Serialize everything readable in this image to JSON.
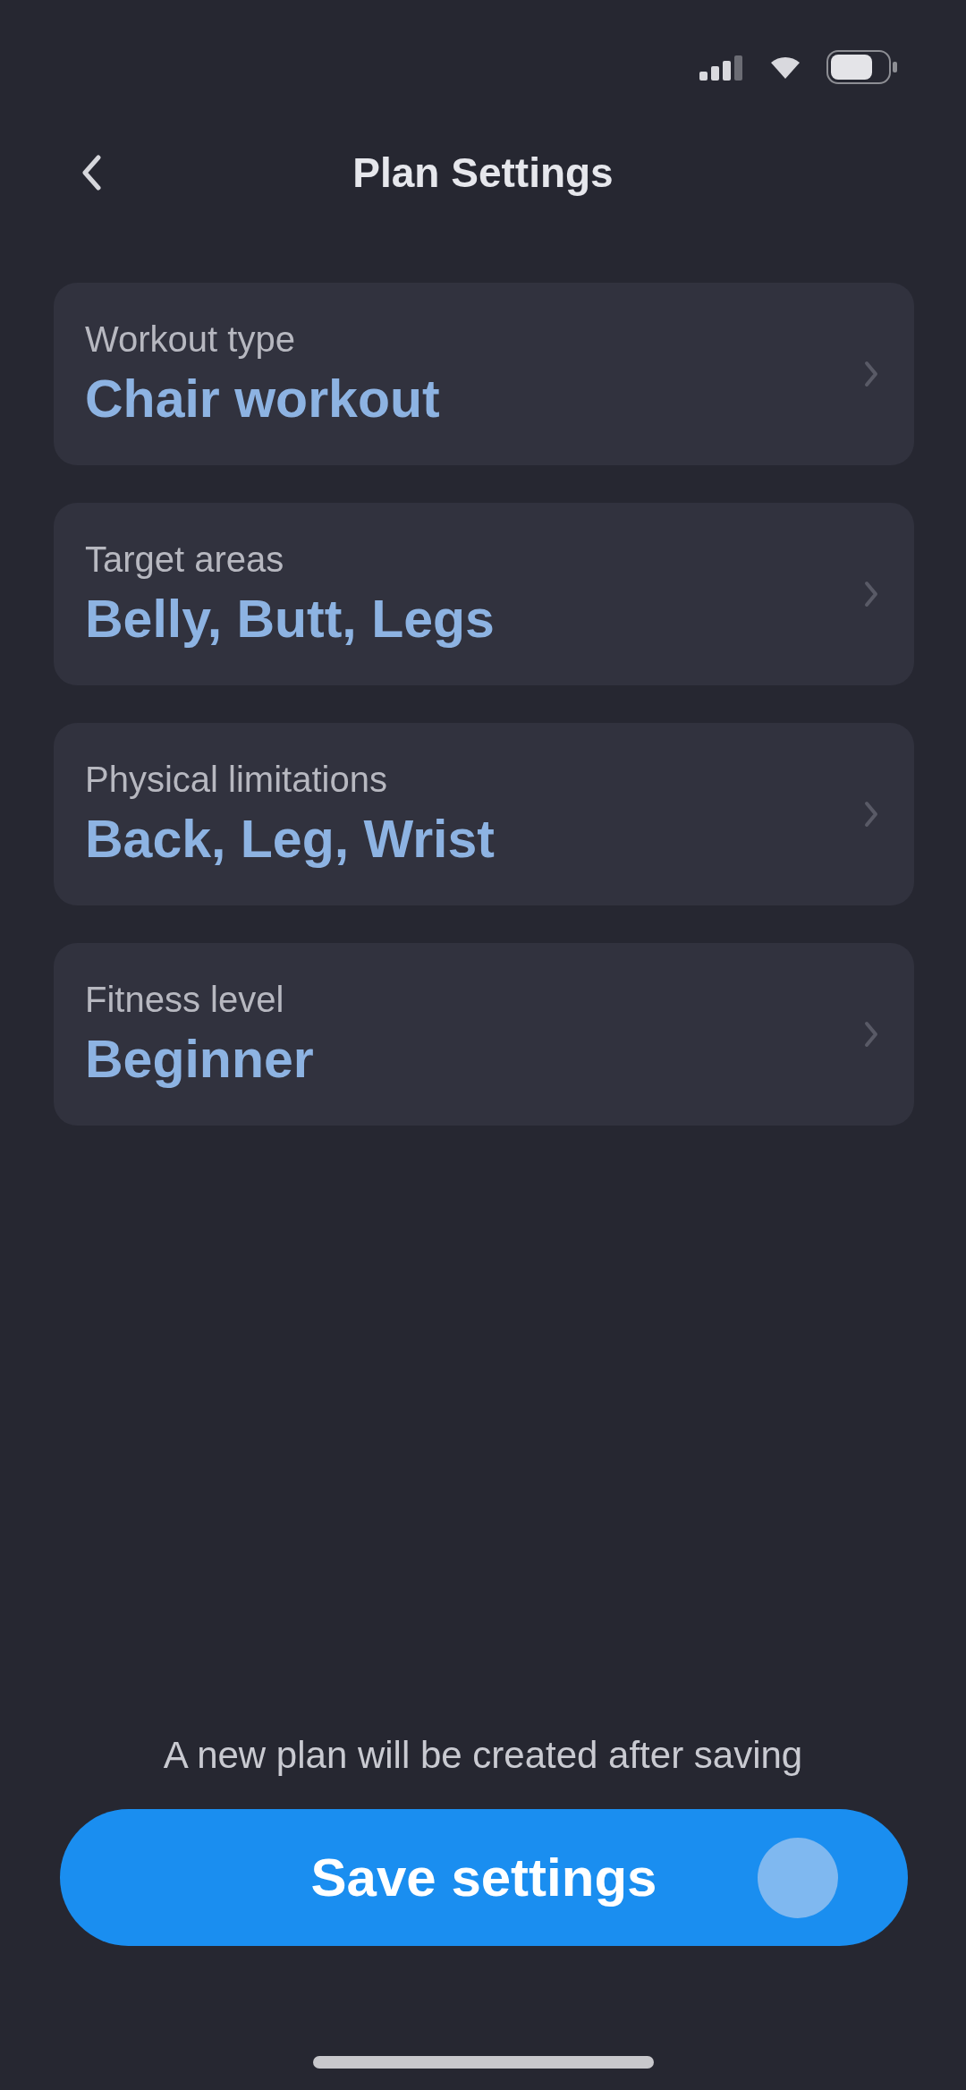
{
  "header": {
    "title": "Plan Settings"
  },
  "settings": [
    {
      "label": "Workout type",
      "value": "Chair workout"
    },
    {
      "label": "Target areas",
      "value": "Belly, Butt, Legs"
    },
    {
      "label": "Physical limitations",
      "value": "Back, Leg, Wrist"
    },
    {
      "label": "Fitness level",
      "value": "Beginner"
    }
  ],
  "footer": {
    "note": "A new plan will be created after saving",
    "button": "Save settings"
  }
}
